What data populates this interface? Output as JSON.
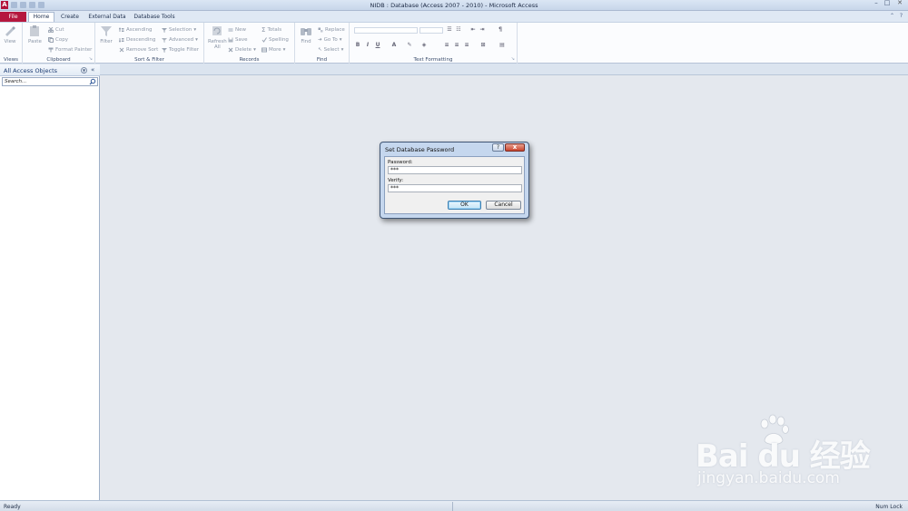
{
  "window": {
    "title": "NIDB : Database (Access 2007 - 2010) - Microsoft Access",
    "app_icon_letter": "A",
    "controls": [
      "minimize",
      "maximize",
      "close"
    ]
  },
  "tabs": {
    "file": "File",
    "items": [
      "Home",
      "Create",
      "External Data",
      "Database Tools"
    ],
    "active": "Home"
  },
  "ribbon": {
    "views": {
      "view": "View",
      "label": "Views"
    },
    "clipboard": {
      "paste": "Paste",
      "cut": "Cut",
      "copy": "Copy",
      "format_painter": "Format Painter",
      "label": "Clipboard"
    },
    "sort_filter": {
      "filter": "Filter",
      "ascending": "Ascending",
      "descending": "Descending",
      "remove_sort": "Remove Sort",
      "selection": "Selection",
      "advanced": "Advanced",
      "toggle_filter": "Toggle Filter",
      "label": "Sort & Filter"
    },
    "records": {
      "refresh": "Refresh",
      "refresh_sub": "All",
      "new": "New",
      "save": "Save",
      "delete": "Delete",
      "totals": "Totals",
      "spelling": "Spelling",
      "more": "More",
      "label": "Records"
    },
    "find": {
      "find": "Find",
      "replace": "Replace",
      "goto": "Go To",
      "select": "Select",
      "label": "Find"
    },
    "text_formatting": {
      "label": "Text Formatting",
      "bold": "B",
      "italic": "I",
      "underline": "U",
      "font_color": "A"
    }
  },
  "nav_pane": {
    "title": "All Access Objects",
    "search_placeholder": "Search..."
  },
  "dialog": {
    "title": "Set Database Password",
    "help": "?",
    "close": "x",
    "password_label": "Password:",
    "password_value": "***",
    "verify_label": "Verify:",
    "verify_value": "***",
    "ok": "OK",
    "cancel": "Cancel"
  },
  "status": {
    "left": "Ready",
    "right": "Num Lock"
  },
  "watermark": {
    "logo": "Bai du 经验",
    "url": "jingyan.baidu.com"
  },
  "colors": {
    "file_tab": "#b5173e",
    "dialog_frame": "#c5d7ee",
    "close_button": "#c9442d",
    "workspace": "#e4e8ee"
  }
}
